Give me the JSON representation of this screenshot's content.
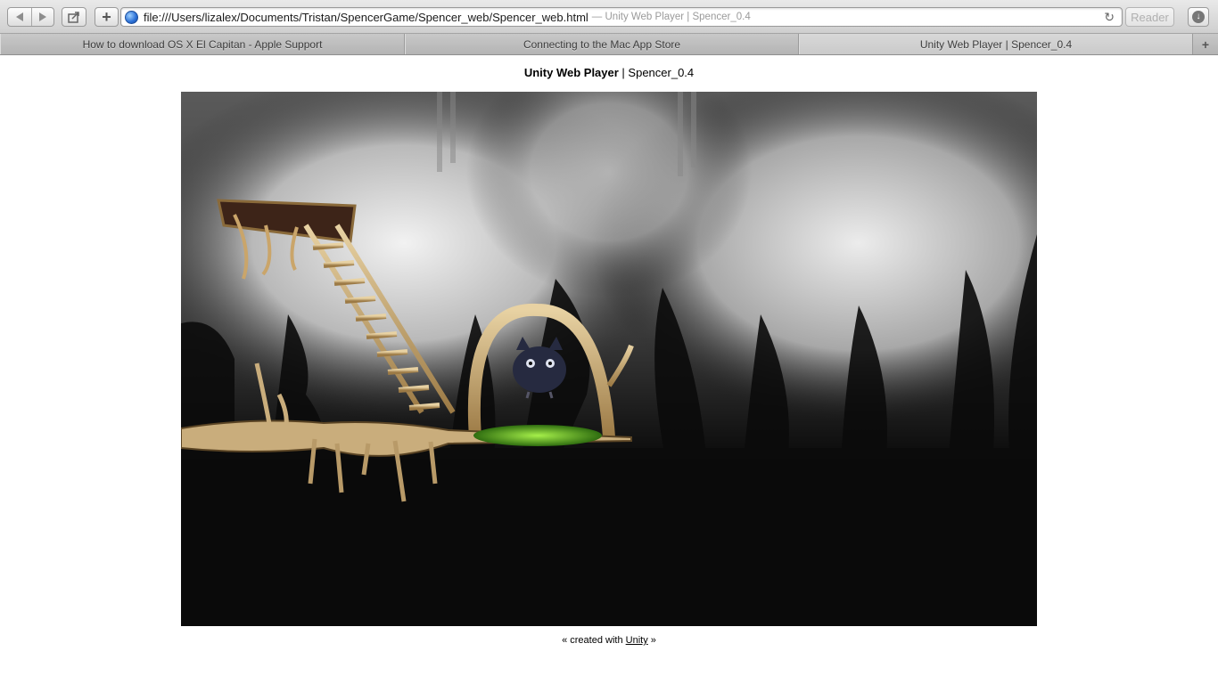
{
  "toolbar": {
    "url": "file:///Users/lizalex/Documents/Tristan/SpencerGame/Spencer_web/Spencer_web.html",
    "url_title": "— Unity Web Player | Spencer_0.4",
    "reader_label": "Reader",
    "new_tab_symbol": "+",
    "icons": {
      "back": "back-arrow-icon",
      "forward": "forward-arrow-icon",
      "share": "share-icon",
      "globe": "globe-icon",
      "reload": "reload-icon",
      "download": "download-icon"
    }
  },
  "tabs": [
    {
      "label": "How to download OS X El Capitan - Apple Support",
      "active": false
    },
    {
      "label": "Connecting to the Mac App Store",
      "active": false
    },
    {
      "label": "Unity Web Player | Spencer_0.4",
      "active": true
    }
  ],
  "page": {
    "title_bold": "Unity Web Player",
    "title_sep": " | ",
    "title_rest": "Spencer_0.4",
    "footer_prefix": "« created with ",
    "footer_link": "Unity",
    "footer_suffix": " »"
  }
}
